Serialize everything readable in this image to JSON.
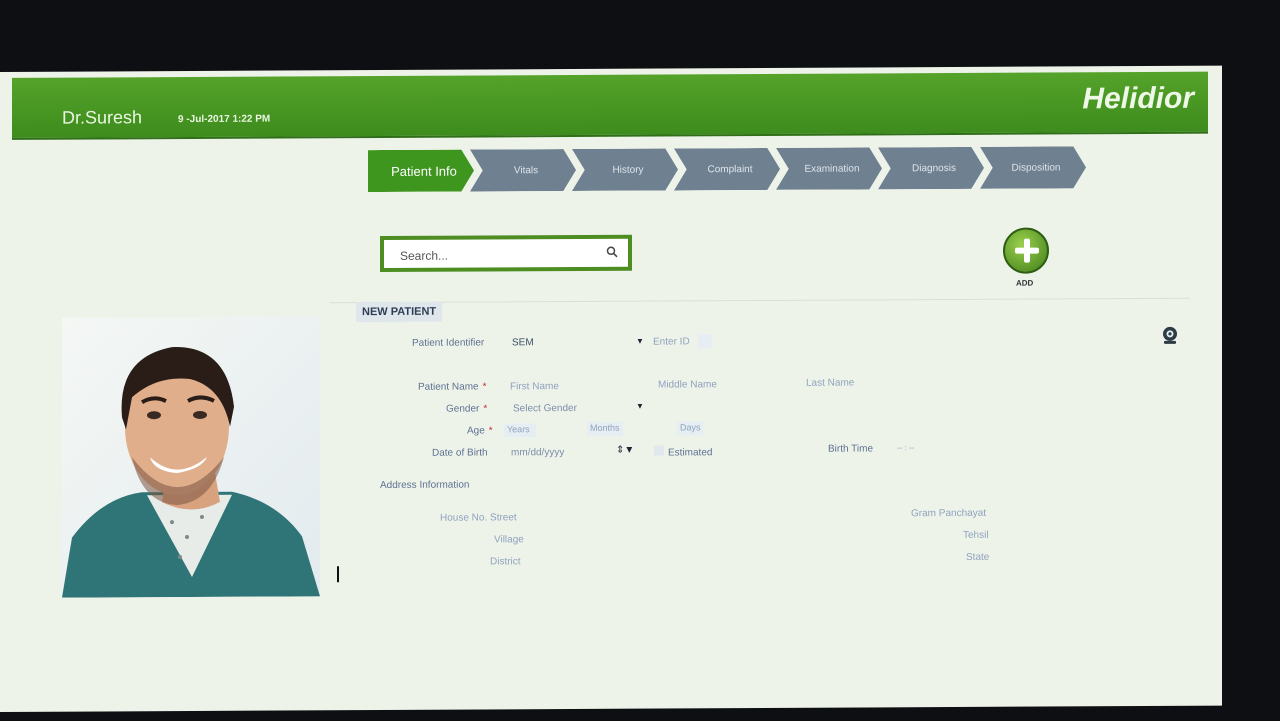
{
  "header": {
    "doctor_name": "Dr.Suresh",
    "datetime": "9 -Jul-2017 1:22 PM",
    "brand": "Helidior"
  },
  "steps": [
    {
      "label": "Patient Info",
      "active": true
    },
    {
      "label": "Vitals"
    },
    {
      "label": "History"
    },
    {
      "label": "Complaint"
    },
    {
      "label": "Examination"
    },
    {
      "label": "Diagnosis"
    },
    {
      "label": "Disposition"
    }
  ],
  "search": {
    "placeholder": "Search..."
  },
  "add": {
    "label": "ADD"
  },
  "section": {
    "title": "NEW PATIENT"
  },
  "form": {
    "identifier_label": "Patient Identifier",
    "identifier_value": "SEM",
    "enter_id_placeholder": "Enter ID",
    "name_label": "Patient Name",
    "first_name_placeholder": "First Name",
    "middle_name_placeholder": "Middle Name",
    "last_name_placeholder": "Last Name",
    "gender_label": "Gender",
    "gender_placeholder": "Select Gender",
    "age_label": "Age",
    "years_placeholder": "Years",
    "months_placeholder": "Months",
    "days_placeholder": "Days",
    "dob_label": "Date of Birth",
    "dob_placeholder": "mm/dd/yyyy",
    "estimated_label": "Estimated",
    "birth_time_label": "Birth Time",
    "birth_time_placeholder": "-- : --",
    "address_title": "Address Information",
    "house_label": "House No. Street",
    "village_label": "Village",
    "district_label": "District",
    "gram_label": "Gram Panchayat",
    "tehsil_label": "Tehsil",
    "state_label": "State",
    "required_mark": "*"
  },
  "colors": {
    "brand_green": "#4c9a26",
    "step_gray": "#6f8090"
  }
}
